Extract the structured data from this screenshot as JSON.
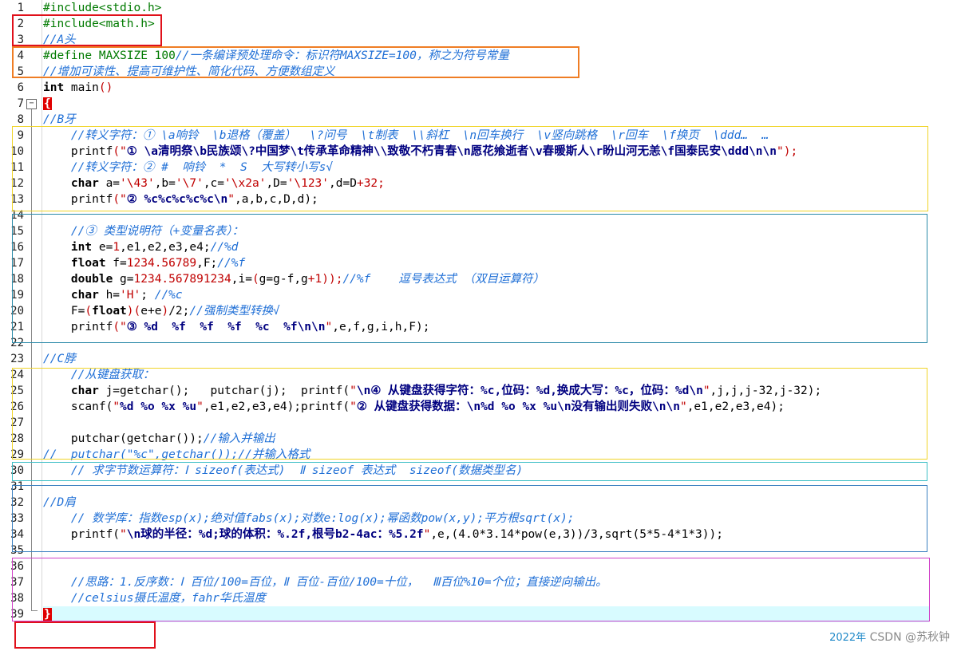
{
  "lines": [
    [
      {
        "t": "#include<stdio.h>",
        "c": "pp"
      }
    ],
    [
      {
        "t": "#include<math.h>",
        "c": "pp"
      }
    ],
    [
      {
        "t": "//A头",
        "c": "cm"
      }
    ],
    [
      {
        "t": "#define MAXSIZE 100",
        "c": "pp"
      },
      {
        "t": "//一条编译预处理命令：标识符MAXSIZE=100，称之为符号常量",
        "c": "cm"
      }
    ],
    [
      {
        "t": "//增加可读性、提高可维护性、简化代码、方便数组定义",
        "c": "cm"
      }
    ],
    [
      {
        "t": "int",
        "c": "kw"
      },
      {
        "t": " main"
      },
      {
        "t": "()",
        "c": "br"
      }
    ],
    [
      {
        "t": "{",
        "c": "brace-hl"
      }
    ],
    [
      {
        "t": "//B牙",
        "c": "cm"
      }
    ],
    [
      {
        "t": "    "
      },
      {
        "t": "//转义字符：① \\a响铃  \\b退格（覆盖）  \\?问号  \\t制表  \\\\斜杠  \\n回车换行  \\v竖向跳格  \\r回车  \\f换页  \\ddd…  …",
        "c": "cm"
      }
    ],
    [
      {
        "t": "    printf"
      },
      {
        "t": "(",
        "c": "br"
      },
      {
        "t": "\"",
        "c": "qt"
      },
      {
        "t": "① \\a清明祭\\b民族颂\\?中国梦\\t传承革命精神\\\\致敬不朽青春\\n愿花飨逝者\\v春暖斯人\\r盼山河无恙\\f国泰民安\\ddd\\n\\n",
        "c": "str"
      },
      {
        "t": "\"",
        "c": "qt"
      },
      {
        "t": ");",
        "c": "br"
      }
    ],
    [
      {
        "t": "    "
      },
      {
        "t": "//转义字符：② #  响铃  *  S  大写转小写s√",
        "c": "cm"
      }
    ],
    [
      {
        "t": "    "
      },
      {
        "t": "char",
        "c": "kw"
      },
      {
        "t": " a="
      },
      {
        "t": "'\\43'",
        "c": "num"
      },
      {
        "t": ",b="
      },
      {
        "t": "'\\7'",
        "c": "num"
      },
      {
        "t": ",c="
      },
      {
        "t": "'\\x2a'",
        "c": "num"
      },
      {
        "t": ",D="
      },
      {
        "t": "'\\123'",
        "c": "num"
      },
      {
        "t": ",d="
      },
      {
        "t": "D",
        "c": ""
      },
      {
        "t": "+",
        "c": "op"
      },
      {
        "t": "32",
        "c": "num"
      },
      {
        "t": ";",
        "c": "br"
      }
    ],
    [
      {
        "t": "    printf"
      },
      {
        "t": "(",
        "c": "br"
      },
      {
        "t": "\"",
        "c": "qt"
      },
      {
        "t": "② %c%c%c%c%c\\n",
        "c": "str"
      },
      {
        "t": "\"",
        "c": "qt"
      },
      {
        "t": ",a,b,c,D,d);"
      }
    ],
    [
      {
        "t": ""
      }
    ],
    [
      {
        "t": "    "
      },
      {
        "t": "//③ 类型说明符（+变量名表）：",
        "c": "cm"
      }
    ],
    [
      {
        "t": "    "
      },
      {
        "t": "int",
        "c": "kw"
      },
      {
        "t": " e="
      },
      {
        "t": "1",
        "c": "num"
      },
      {
        "t": ",e1,e2,e3,e4;"
      },
      {
        "t": "//%d",
        "c": "cm"
      }
    ],
    [
      {
        "t": "    "
      },
      {
        "t": "float",
        "c": "kw"
      },
      {
        "t": " f="
      },
      {
        "t": "1234.56789",
        "c": "num"
      },
      {
        "t": ",F;"
      },
      {
        "t": "//%f",
        "c": "cm"
      }
    ],
    [
      {
        "t": "    "
      },
      {
        "t": "double",
        "c": "kw"
      },
      {
        "t": " g="
      },
      {
        "t": "1234.567891234",
        "c": "num"
      },
      {
        "t": ",i="
      },
      {
        "t": "(",
        "c": "br"
      },
      {
        "t": "g=g-f,g"
      },
      {
        "t": "+1",
        "c": "num"
      },
      {
        "t": "));",
        "c": "br"
      },
      {
        "t": "//%f    逗号表达式 （双目运算符）",
        "c": "cm"
      }
    ],
    [
      {
        "t": "    "
      },
      {
        "t": "char",
        "c": "kw"
      },
      {
        "t": " h="
      },
      {
        "t": "'H'",
        "c": "num"
      },
      {
        "t": "; "
      },
      {
        "t": "//%c",
        "c": "cm"
      }
    ],
    [
      {
        "t": "    F="
      },
      {
        "t": "(",
        "c": "br"
      },
      {
        "t": "float",
        "c": "kw"
      },
      {
        "t": ")(",
        "c": "br"
      },
      {
        "t": "e+e"
      },
      {
        "t": ")",
        "c": "br"
      },
      {
        "t": "/2;"
      },
      {
        "t": "//强制类型转换√",
        "c": "cm"
      }
    ],
    [
      {
        "t": "    printf"
      },
      {
        "t": "(",
        "c": "br"
      },
      {
        "t": "\"",
        "c": "qt"
      },
      {
        "t": "③ %d  %f  %f  %f  %c  %f\\n\\n",
        "c": "str"
      },
      {
        "t": "\"",
        "c": "qt"
      },
      {
        "t": ",e,f,g,i,h,F);"
      }
    ],
    [
      {
        "t": ""
      }
    ],
    [
      {
        "t": "//C脖",
        "c": "cm"
      }
    ],
    [
      {
        "t": "    "
      },
      {
        "t": "//从键盘获取：",
        "c": "cm"
      }
    ],
    [
      {
        "t": "    "
      },
      {
        "t": "char",
        "c": "kw"
      },
      {
        "t": " j=getchar();   putchar(j);  printf("
      },
      {
        "t": "\"",
        "c": "qt"
      },
      {
        "t": "\\n④ 从键盘获得字符：%c,位码：%d,换成大写：%c，位码：%d\\n",
        "c": "str"
      },
      {
        "t": "\"",
        "c": "qt"
      },
      {
        "t": ",j,j,j-32,j-32);"
      }
    ],
    [
      {
        "t": "    scanf("
      },
      {
        "t": "\"",
        "c": "qt"
      },
      {
        "t": "%d %o %x %u",
        "c": "str"
      },
      {
        "t": "\"",
        "c": "qt"
      },
      {
        "t": ",e1,e2,e3,e4);printf("
      },
      {
        "t": "\"",
        "c": "qt"
      },
      {
        "t": "② 从键盘获得数据：\\n%d %o %x %u\\n没有输出则失败\\n\\n",
        "c": "str"
      },
      {
        "t": "\"",
        "c": "qt"
      },
      {
        "t": ",e1,e2,e3,e4);"
      }
    ],
    [
      {
        "t": ""
      }
    ],
    [
      {
        "t": "    putchar(getchar());"
      },
      {
        "t": "//输入并输出",
        "c": "cm"
      }
    ],
    [
      {
        "t": "//  putchar(\"%c\",getchar());//并输入格式",
        "c": "cm"
      }
    ],
    [
      {
        "t": "    "
      },
      {
        "t": "// 求字节数运算符：Ⅰ sizeof(表达式)  Ⅱ sizeof 表达式  sizeof(数据类型名)",
        "c": "cm"
      }
    ],
    [
      {
        "t": ""
      }
    ],
    [
      {
        "t": "//D肩",
        "c": "cm"
      }
    ],
    [
      {
        "t": "    "
      },
      {
        "t": "// 数学库：指数esp(x);绝对值fabs(x);对数e:log(x);幂函数pow(x,y);平方根sqrt(x);",
        "c": "cm"
      }
    ],
    [
      {
        "t": "    printf("
      },
      {
        "t": "\"",
        "c": "qt"
      },
      {
        "t": "\\n球的半径：%d;球的体积：%.2f,根号b2-4ac：%5.2f",
        "c": "str"
      },
      {
        "t": "\"",
        "c": "qt"
      },
      {
        "t": ",e,(4.0*3.14*pow(e,3))/3,sqrt(5*5-4*1*3));"
      }
    ],
    [
      {
        "t": ""
      }
    ],
    [
      {
        "t": ""
      }
    ],
    [
      {
        "t": "    "
      },
      {
        "t": "//思路：1.反序数：Ⅰ 百位/100=百位，Ⅱ 百位-百位/100=十位，  Ⅲ百位%10=个位；直接逆向输出。",
        "c": "cm"
      }
    ],
    [
      {
        "t": "    "
      },
      {
        "t": "//celsius摄氏温度，fahr华氏温度",
        "c": "cm"
      }
    ],
    [
      {
        "t": "}",
        "c": "brace-hl"
      }
    ]
  ],
  "watermark": {
    "date": "2022年",
    "text": "CSDN @苏秋钟"
  },
  "annotation_colors": {
    "red": "#e0101a",
    "orange": "#ef7d24",
    "yellow": "#f0d428",
    "teal": "#2a8aa8",
    "cyan": "#3dbfc6",
    "blue": "#3a7fc0",
    "magenta": "#d040c8"
  }
}
